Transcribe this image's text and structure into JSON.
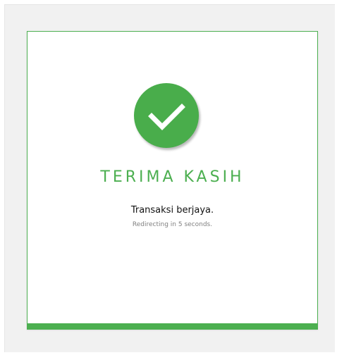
{
  "card": {
    "icon": "checkmark-circle-icon",
    "title": "TERIMA KASIH",
    "message": "Transaksi berjaya.",
    "redirect_text": "Redirecting in 5 seconds."
  },
  "colors": {
    "accent": "#4caf50",
    "icon_circle": "#49ad4b",
    "page_background": "#f1f1f1",
    "card_background": "#ffffff"
  }
}
